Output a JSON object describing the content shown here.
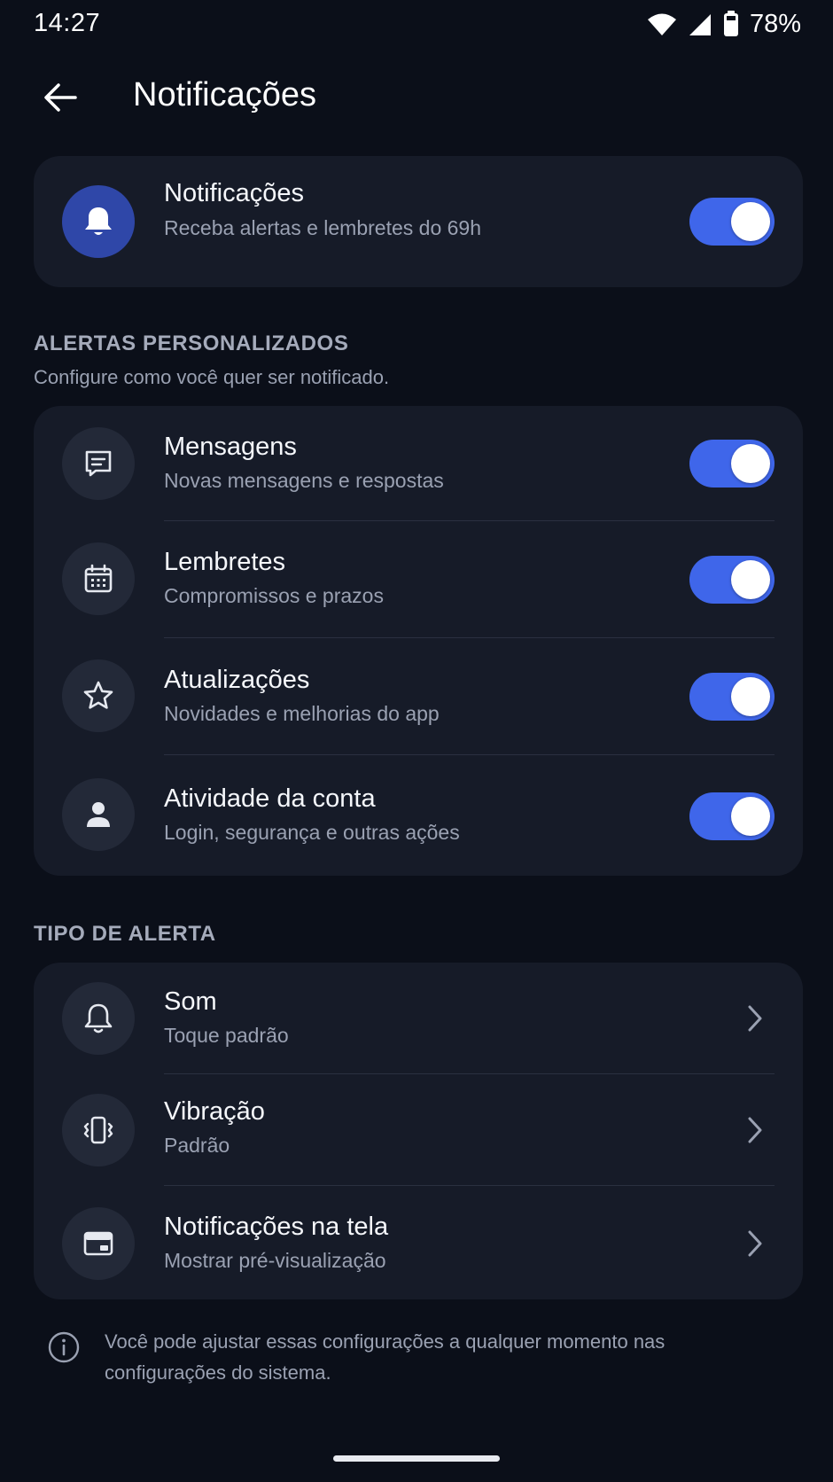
{
  "status_bar": {
    "time": "14:27",
    "battery": "78%"
  },
  "header": {
    "title": "Notificações"
  },
  "master": {
    "title": "Notificações",
    "subtitle": "Receba alertas e lembretes do 69h",
    "enabled": true,
    "icon": "bell-filled-icon"
  },
  "alerts_section": {
    "title": "ALERTAS PERSONALIZADOS",
    "description": "Configure como você quer ser notificado.",
    "items": [
      {
        "title": "Mensagens",
        "subtitle": "Novas mensagens e respostas",
        "enabled": true,
        "icon": "message-icon"
      },
      {
        "title": "Lembretes",
        "subtitle": "Compromissos e prazos",
        "enabled": true,
        "icon": "calendar-icon"
      },
      {
        "title": "Atualizações",
        "subtitle": "Novidades e melhorias do app",
        "enabled": true,
        "icon": "star-icon"
      },
      {
        "title": "Atividade da conta",
        "subtitle": "Login, segurança e outras ações",
        "enabled": true,
        "icon": "person-icon"
      }
    ]
  },
  "type_section": {
    "title": "TIPO DE ALERTA",
    "items": [
      {
        "title": "Som",
        "subtitle": "Toque padrão",
        "icon": "bell-outline-icon"
      },
      {
        "title": "Vibração",
        "subtitle": "Padrão",
        "icon": "vibration-icon"
      },
      {
        "title": "Notificações na tela",
        "subtitle": "Mostrar pré-visualização",
        "icon": "screen-icon"
      }
    ]
  },
  "info": {
    "text": "Você pode ajustar essas configurações a qualquer momento nas configurações do sistema."
  },
  "colors": {
    "background": "#0b0f19",
    "card": "#161b28",
    "accent": "#3f66ea",
    "icon_circle": "#232938",
    "primary_circle": "#2f47a8"
  }
}
